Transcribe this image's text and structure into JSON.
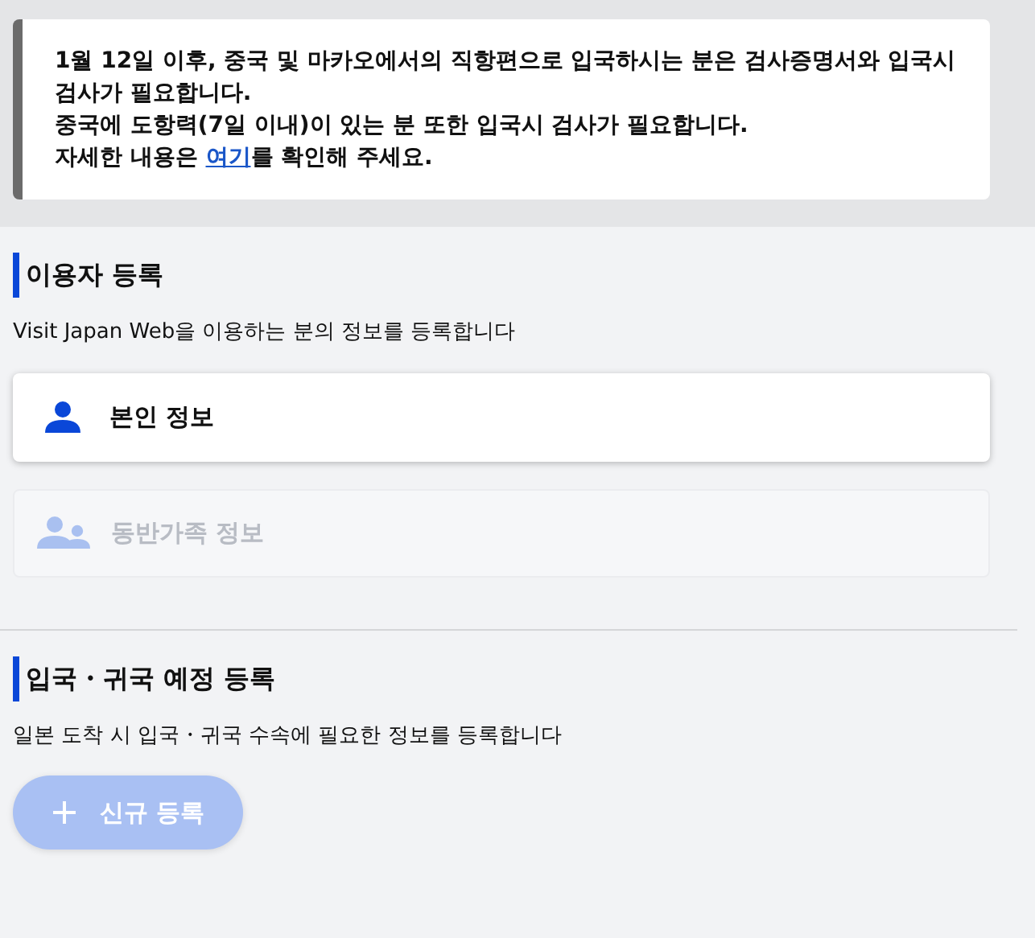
{
  "notice": {
    "lines": [
      "1월 12일 이후, 중국 및 마카오에서의 직항편으로 입국하시는 분은 검사증명서와 입국시 검사가 필요합니다.",
      "중국에 도항력(7일 이내)이 있는 분 또한 입국시 검사가 필요합니다."
    ],
    "detail": {
      "before": "자세한 내용은 ",
      "link": "여기",
      "after": "를 확인해 주세요."
    }
  },
  "sections": [
    {
      "title": "이용자 등록",
      "description": "Visit Japan Web을 이용하는 분의 정보를 등록합니다",
      "cards": [
        {
          "label": "본인 정보",
          "kind": "self",
          "disabled": false
        },
        {
          "label": "동반가족 정보",
          "kind": "family",
          "disabled": true
        }
      ]
    },
    {
      "title": "입국・귀국 예정 등록",
      "description": "일본 도착 시 입국・귀국 수속에 필요한 정보를 등록합니다",
      "button": {
        "label": "신규 등록",
        "disabled": true
      }
    }
  ]
}
